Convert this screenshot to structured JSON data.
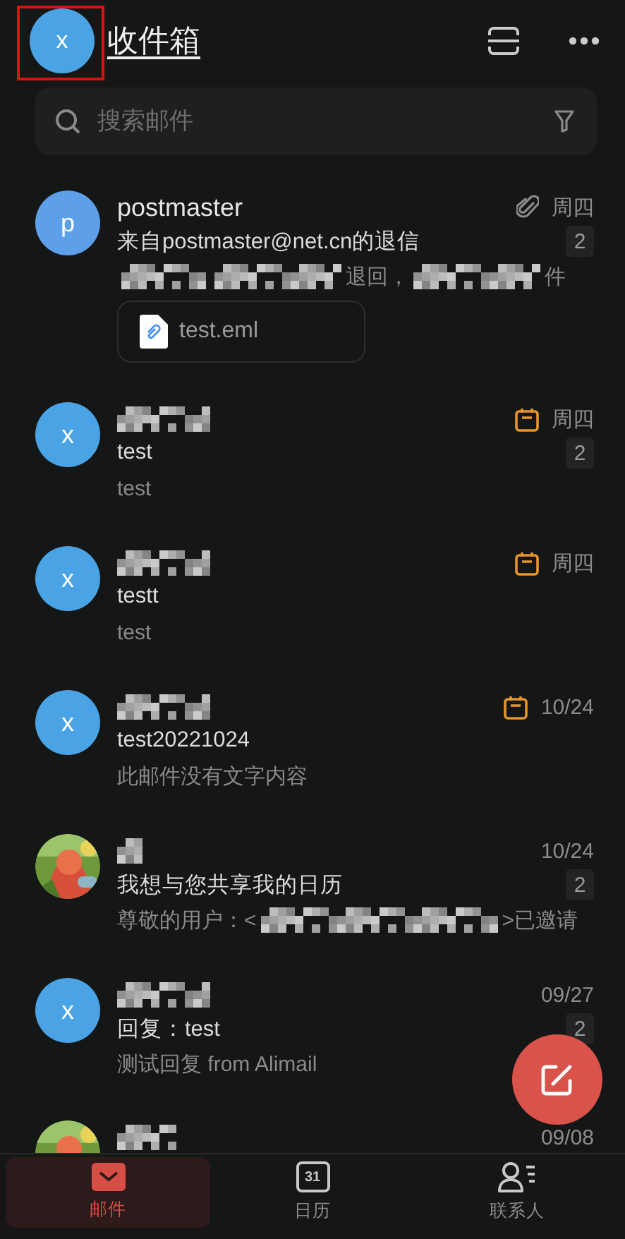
{
  "header": {
    "avatar": {
      "letter": "x",
      "color": "#4aa3e4"
    },
    "highlighted": true,
    "title": "收件箱"
  },
  "search": {
    "placeholder": "搜索邮件"
  },
  "messages": [
    {
      "avatar": {
        "kind": "letter",
        "letter": "p",
        "color": "#5e9fe9"
      },
      "sender": [
        {
          "kind": "text",
          "text": "postmaster"
        }
      ],
      "kind": "attachment",
      "date": "周四",
      "subject": "来自postmaster@net.cn的退信",
      "count": "2",
      "preview": [
        {
          "kind": "redacted"
        },
        {
          "kind": "redacted"
        },
        {
          "kind": "text",
          "text": "退回，"
        },
        {
          "kind": "redacted"
        },
        {
          "kind": "text",
          "text": "件"
        }
      ],
      "attachments": [
        "test.eml"
      ]
    },
    {
      "avatar": {
        "kind": "letter",
        "letter": "x",
        "color": "#4aa3e4"
      },
      "sender": [
        {
          "kind": "redacted"
        }
      ],
      "kind": "calendar",
      "date": "周四",
      "subject": "test",
      "count": "2",
      "preview": [
        {
          "kind": "text",
          "text": "test"
        }
      ]
    },
    {
      "avatar": {
        "kind": "letter",
        "letter": "x",
        "color": "#4aa3e4"
      },
      "sender": [
        {
          "kind": "redacted"
        }
      ],
      "kind": "calendar",
      "date": "周四",
      "subject": "testt",
      "preview": [
        {
          "kind": "text",
          "text": "test"
        }
      ]
    },
    {
      "avatar": {
        "kind": "letter",
        "letter": "x",
        "color": "#4aa3e4"
      },
      "sender": [
        {
          "kind": "redacted"
        }
      ],
      "kind": "calendar",
      "date": "10/24",
      "subject": "test20221024",
      "preview": [
        {
          "kind": "text",
          "text": "此邮件没有文字内容"
        }
      ]
    },
    {
      "sender": [
        {
          "kind": "redacted"
        }
      ],
      "date": "10/24",
      "subject": "我想与您共享我的日历",
      "count": "2",
      "preview": [
        {
          "kind": "text",
          "text": "尊敬的用户：<"
        },
        {
          "kind": "redacted"
        },
        {
          "kind": "text",
          "text": ">已邀请"
        }
      ]
    },
    {
      "avatar": {
        "kind": "letter",
        "letter": "x",
        "color": "#4aa3e4"
      },
      "sender": [
        {
          "kind": "redacted"
        }
      ],
      "date": "09/27",
      "subject": "回复：test",
      "count": "2",
      "preview": [
        {
          "kind": "text",
          "text": "测试回复 from Alimail"
        }
      ]
    },
    {
      "sender": [
        {
          "kind": "redacted"
        }
      ],
      "date": "09/08"
    }
  ],
  "nav": [
    {
      "kind": "mail",
      "label": "邮件",
      "selected": true
    },
    {
      "kind": "calendar",
      "icon_text": "31",
      "label": "日历",
      "selected": false
    },
    {
      "kind": "contacts",
      "label": "联系人",
      "selected": false
    }
  ]
}
